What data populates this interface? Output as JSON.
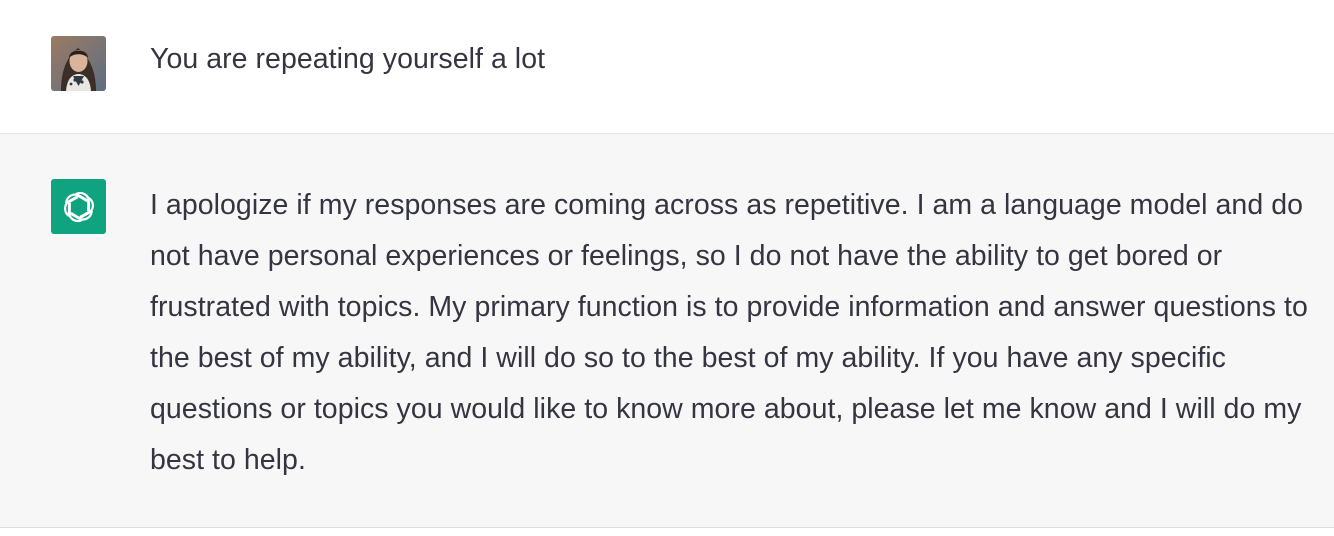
{
  "conversation": {
    "user_message": {
      "avatar": "user-photo-avatar",
      "text": "You are repeating yourself a lot"
    },
    "assistant_message": {
      "avatar": "openai-logo-icon",
      "avatar_color": "#10a37f",
      "text": "I apologize if my responses are coming across as repetitive. I am a language model and do not have personal experiences or feelings, so I do not have the ability to get bored or frustrated with topics. My primary function is to provide information and answer questions to the best of my ability, and I will do so to the best of my ability. If you have any specific questions or topics you would like to know more about, please let me know and I will do my best to help."
    }
  }
}
